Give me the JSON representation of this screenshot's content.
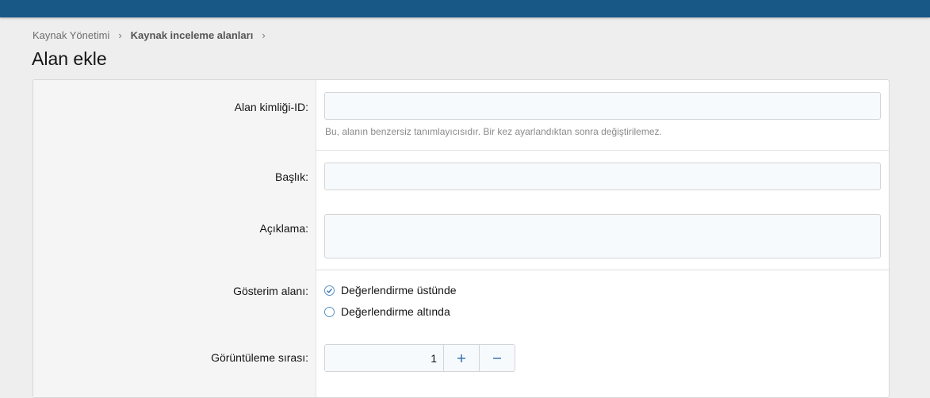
{
  "breadcrumb": {
    "items": [
      "Kaynak Yönetimi",
      "Kaynak inceleme alanları"
    ],
    "separator": "›"
  },
  "page": {
    "title": "Alan ekle"
  },
  "form": {
    "field_id": {
      "label": "Alan kimliği-ID:",
      "value": "",
      "hint": "Bu, alanın benzersiz tanımlayıcısıdır. Bir kez ayarlandıktan sonra değiştirilemez."
    },
    "title": {
      "label": "Başlık:",
      "value": ""
    },
    "description": {
      "label": "Açıklama:",
      "value": ""
    },
    "display_location": {
      "label": "Gösterim alanı:",
      "options": [
        {
          "label": "Değerlendirme üstünde",
          "selected": true
        },
        {
          "label": "Değerlendirme altında",
          "selected": false
        }
      ]
    },
    "display_order": {
      "label": "Görüntüleme sırası:",
      "value": "1",
      "plus_icon": "plus-icon",
      "minus_icon": "minus-icon"
    }
  },
  "colors": {
    "topbar": "#185886",
    "accent": "#3b79b5"
  }
}
